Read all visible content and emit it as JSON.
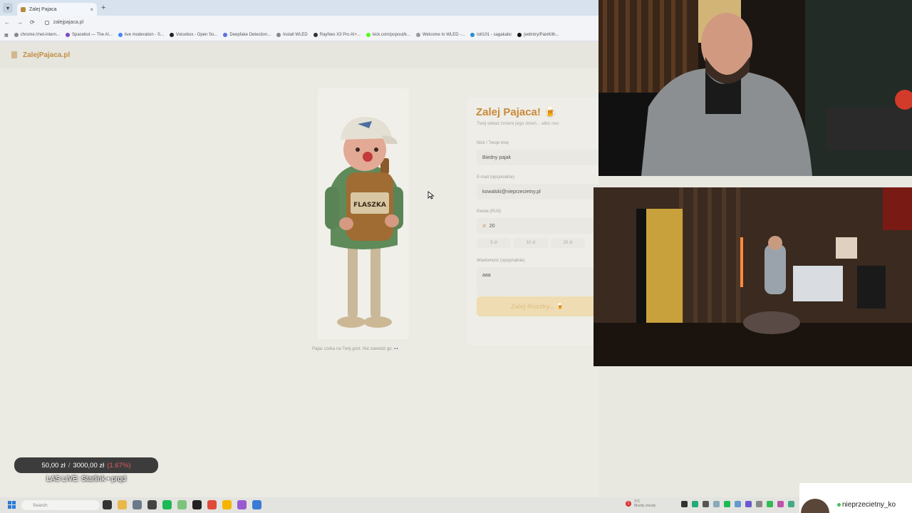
{
  "browser": {
    "tab_title": "Zalej Pajaca",
    "new_tab_glyph": "+",
    "close_glyph": "×",
    "url": "zalejpajaca.pl",
    "bookmarks": [
      "chrome://net-intern...",
      "Spacebot — The AI...",
      "live moderation - S...",
      "Voicebox - Open So...",
      "Deepfake Detection...",
      "Install WLED",
      "RayNeo X3 Pro AI+...",
      "kick.com/popout/k...",
      "Welcome to WLED -...",
      "lott101 - sagakabc",
      "jwdmtry/PaixKith..."
    ]
  },
  "site": {
    "logo": "ZalejPajaca.pl",
    "figure_caption": "Pajac czeka na Twój gest. Nie zawiedź go. 👀",
    "figure_bottle_label": "FLASZKA",
    "form": {
      "title": "Zalej Pajaca! 🍺",
      "subtitle": "Twój wkład zmieni jego dzień... albo noc",
      "nick_label": "Nick / Twoje imię",
      "nick_value": "Biedny pajak",
      "email_label": "E-mail (opcjonalnie)",
      "email_value": "kowalski@nieprzecietny.pl",
      "amount_label": "Kwota (PLN)",
      "currency": "zł",
      "amount_value": "20",
      "presets": [
        "5 zł",
        "10 zł",
        "20 zł"
      ],
      "message_label": "Wiadomość (opcjonalnie)",
      "message_value": "aaa",
      "submit_label": "Zalej Ruszky... 🍺"
    }
  },
  "overlay": {
    "donation_current": "50,00 zł",
    "donation_sep": "/",
    "donation_goal": "3000,00 zł",
    "donation_pct": "(1.67%)",
    "donation_fraction": 0.0167,
    "stream_title": "LAS LIVE: Starlink • prqd",
    "username": "nieprzecietny_ko"
  },
  "taskbar": {
    "search_placeholder": "Search",
    "weather_temp": "3°C",
    "weather_desc": "Mostly cloudy",
    "notif_count": "1"
  },
  "colors": {
    "accent": "#c9893a",
    "donation_pct": "#e45b5b",
    "online": "#3dc35a"
  }
}
